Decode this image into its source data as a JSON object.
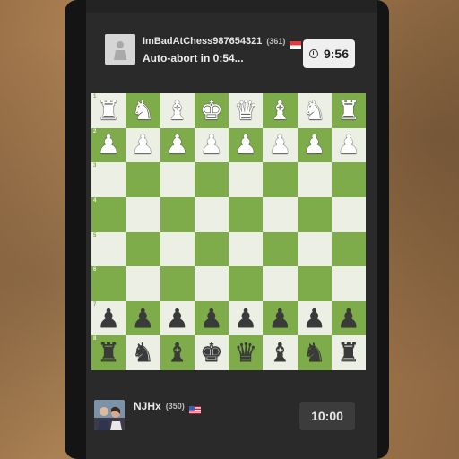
{
  "opponent": {
    "username": "ImBadAtChess987654321",
    "rating": "(361)",
    "status": "Auto-abort in 0:54...",
    "clock": "9:56",
    "flag_colors": [
      "#e23b3b",
      "#ffffff"
    ]
  },
  "player": {
    "username": "NJHx",
    "rating": "(350)",
    "clock": "10:00",
    "flag_colors": [
      "#3c5bb5",
      "#c8102e",
      "#ffffff"
    ]
  },
  "board": {
    "light_color": "#ecefe3",
    "dark_color": "#7fac4a",
    "rank_labels": [
      "1",
      "2",
      "3",
      "4",
      "5",
      "6",
      "7",
      "8"
    ],
    "rows": [
      [
        "wR",
        "wN",
        "wB",
        "wK",
        "wQ",
        "wB",
        "wN",
        "wR"
      ],
      [
        "wP",
        "wP",
        "wP",
        "wP",
        "wP",
        "wP",
        "wP",
        "wP"
      ],
      [
        "",
        "",
        "",
        "",
        "",
        "",
        "",
        ""
      ],
      [
        "",
        "",
        "",
        "",
        "",
        "",
        "",
        ""
      ],
      [
        "",
        "",
        "",
        "",
        "",
        "",
        "",
        ""
      ],
      [
        "",
        "",
        "",
        "",
        "",
        "",
        "",
        ""
      ],
      [
        "bP",
        "bP",
        "bP",
        "bP",
        "bP",
        "bP",
        "bP",
        "bP"
      ],
      [
        "bR",
        "bN",
        "bB",
        "bK",
        "bQ",
        "bB",
        "bN",
        "bR"
      ]
    ]
  }
}
